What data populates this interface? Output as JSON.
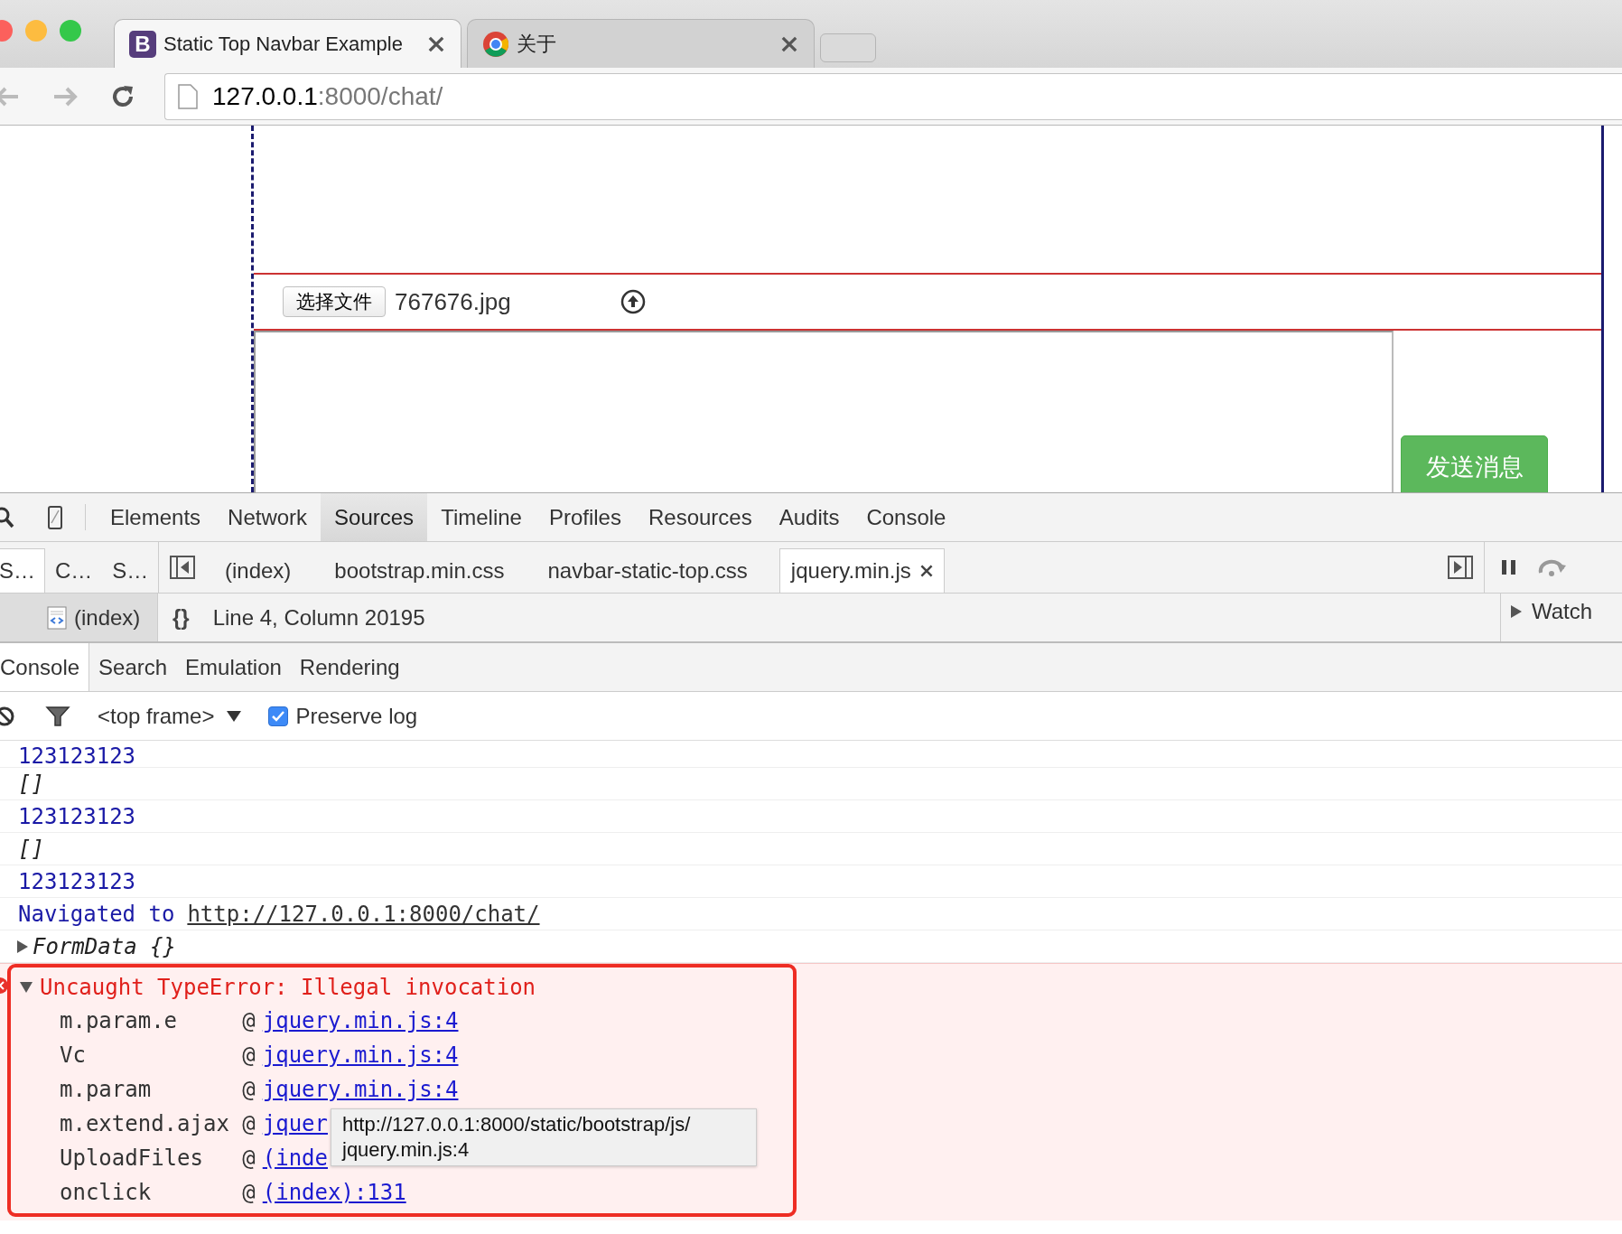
{
  "browser": {
    "tabs": [
      {
        "title": "Static Top Navbar Example",
        "icon_letter": "B",
        "selected": true
      },
      {
        "title": "关于",
        "selected": false
      }
    ],
    "address": {
      "host": "127.0.0.1",
      "rest": ":8000/chat/"
    }
  },
  "page": {
    "file_button": "选择文件",
    "file_name": "767676.jpg",
    "send_button": "发送消息"
  },
  "devtools": {
    "panels": [
      {
        "label": "Elements",
        "selected": false
      },
      {
        "label": "Network",
        "selected": false
      },
      {
        "label": "Sources",
        "selected": true
      },
      {
        "label": "Timeline",
        "selected": false
      },
      {
        "label": "Profiles",
        "selected": false
      },
      {
        "label": "Resources",
        "selected": false
      },
      {
        "label": "Audits",
        "selected": false
      },
      {
        "label": "Console",
        "selected": false
      }
    ],
    "navigator_tabs": [
      {
        "label": "S…",
        "selected": true
      },
      {
        "label": "C…",
        "selected": false
      },
      {
        "label": "S…",
        "selected": false
      }
    ],
    "editor_tabs": [
      {
        "label": "(index)",
        "selected": false
      },
      {
        "label": "bootstrap.min.css",
        "selected": false
      },
      {
        "label": "navbar-static-top.css",
        "selected": false
      },
      {
        "label": "jquery.min.js",
        "selected": true
      }
    ],
    "navigator_item": {
      "label": "(index)",
      "selected": true
    },
    "format_button": "{}",
    "cursor_position": "Line 4, Column 20195",
    "sidebar": {
      "watch": "Watch",
      "expanded": false
    },
    "drawer_tabs": [
      {
        "label": "Console",
        "selected": true
      },
      {
        "label": "Search",
        "selected": false
      },
      {
        "label": "Emulation",
        "selected": false
      },
      {
        "label": "Rendering",
        "selected": false
      }
    ],
    "console_toolbar": {
      "frame": "<top frame>",
      "preserve_log": {
        "label": "Preserve log",
        "checked": true
      }
    },
    "messages": [
      {
        "kind": "number",
        "text": "123123123"
      },
      {
        "kind": "array",
        "text": "[]"
      },
      {
        "kind": "number",
        "text": "123123123"
      },
      {
        "kind": "array",
        "text": "[]"
      },
      {
        "kind": "number",
        "text": "123123123"
      },
      {
        "kind": "navigation",
        "text": "Navigated to",
        "url": "http://127.0.0.1:8000/chat/"
      },
      {
        "kind": "object",
        "text": "FormData {}",
        "expanded": false
      }
    ],
    "error": {
      "message": "Uncaught TypeError: Illegal invocation",
      "expanded": true,
      "stack": [
        {
          "function": "m.param.e",
          "at": "@",
          "link": "jquery.min.js:4"
        },
        {
          "function": "Vc",
          "at": "@",
          "link": "jquery.min.js:4"
        },
        {
          "function": "m.param",
          "at": "@",
          "link": "jquery.min.js:4"
        },
        {
          "function": "m.extend.ajax",
          "at": "@",
          "link": "jquer"
        },
        {
          "function": "UploadFiles",
          "at": "@",
          "link": "(inde"
        },
        {
          "function": "onclick",
          "at": "@",
          "link": "(index):131"
        }
      ],
      "tooltip": [
        "http://127.0.0.1:8000/static/bootstrap/js/",
        "jquery.min.js:4"
      ]
    }
  }
}
